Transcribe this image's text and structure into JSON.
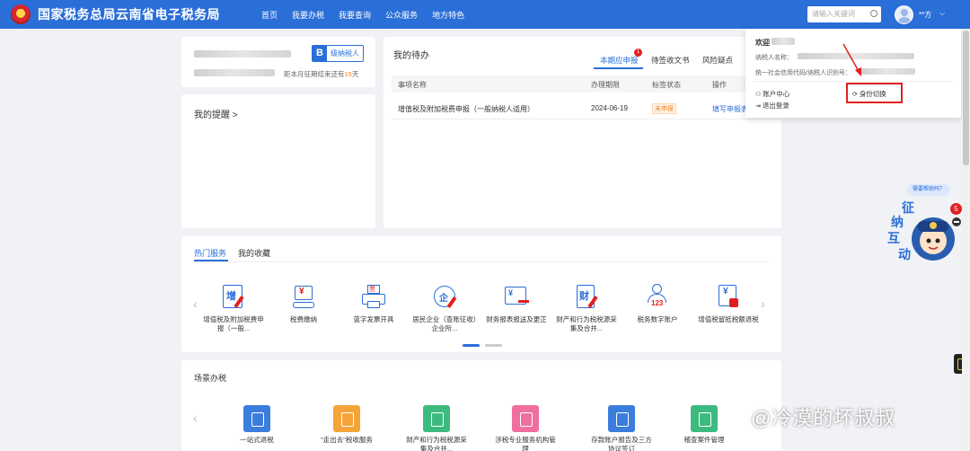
{
  "header": {
    "brand": "国家税务总局云南省电子税务局",
    "nav": [
      "首页",
      "我要办税",
      "我要查询",
      "公众服务",
      "地方特色"
    ],
    "search_placeholder": "请输入关键词",
    "user_name": "**方",
    "caret": "⌵"
  },
  "profile": {
    "badge_letter": "B",
    "badge_text": "级纳税人",
    "deadline_prefix": "距本月征期结束还有",
    "deadline_days": "15",
    "deadline_suffix": "天"
  },
  "reminder": {
    "title": "我的提醒 >"
  },
  "todo": {
    "title": "我的待办",
    "tabs": [
      "本期应申报",
      "待签收文书",
      "风险疑点"
    ],
    "tab_badge": "1",
    "columns": [
      "事项名称",
      "办理期限",
      "标签状态",
      "操作"
    ],
    "rows": [
      {
        "name": "增值税及附加税费申报（一般纳税人适用）",
        "deadline": "2024-06-19",
        "status": "未申报",
        "action": "填写申报表"
      }
    ]
  },
  "dropdown": {
    "greeting": "欢迎",
    "taxpayer_label": "纳税人名称：",
    "credit_code_label": "统一社会信用代码/纳税人识别号：",
    "account_center": "账户中心",
    "switch_identity": "身份切换",
    "logout": "退出登录"
  },
  "hot_services": {
    "tabs": [
      "热门服务",
      "我的收藏"
    ],
    "items": [
      {
        "label": "增值税及附加税费申报（一般...",
        "glyph": "增"
      },
      {
        "label": "税费缴纳",
        "glyph": "¥"
      },
      {
        "label": "蓝字发票开具",
        "glyph": "票"
      },
      {
        "label": "居民企业（查账征收）企业所...",
        "glyph": "企"
      },
      {
        "label": "财务报表报送及更正",
        "glyph": "¥"
      },
      {
        "label": "财产和行为税税源采集及合并...",
        "glyph": "财"
      },
      {
        "label": "税务数字账户",
        "glyph": "123"
      },
      {
        "label": "增值税留抵税额退税",
        "glyph": "¥"
      }
    ]
  },
  "scene": {
    "title": "场景办税",
    "items": [
      {
        "label": "一站式退税",
        "color": "#3b7ddd"
      },
      {
        "label": "\"走出去\"税收服务",
        "color": "#f5a43a"
      },
      {
        "label": "财产和行为税税源采集及合并...",
        "color": "#3dbb7e"
      },
      {
        "label": "涉税专业服务机构管理",
        "color": "#f06fa0"
      },
      {
        "label": "存款账户报告及三方协议签订",
        "color": "#3b7ddd"
      },
      {
        "label": "稽查案件管理",
        "color": "#3dbb7e"
      }
    ]
  },
  "assistant": {
    "bubble": "需要帮助吗？",
    "badge": "5",
    "chars": [
      "征",
      "纳",
      "互",
      "动"
    ]
  },
  "watermark": "@冷漠的坏叔叔",
  "colors": {
    "primary": "#2a6ed8",
    "danger": "#e02020",
    "warning": "#f08a24"
  }
}
